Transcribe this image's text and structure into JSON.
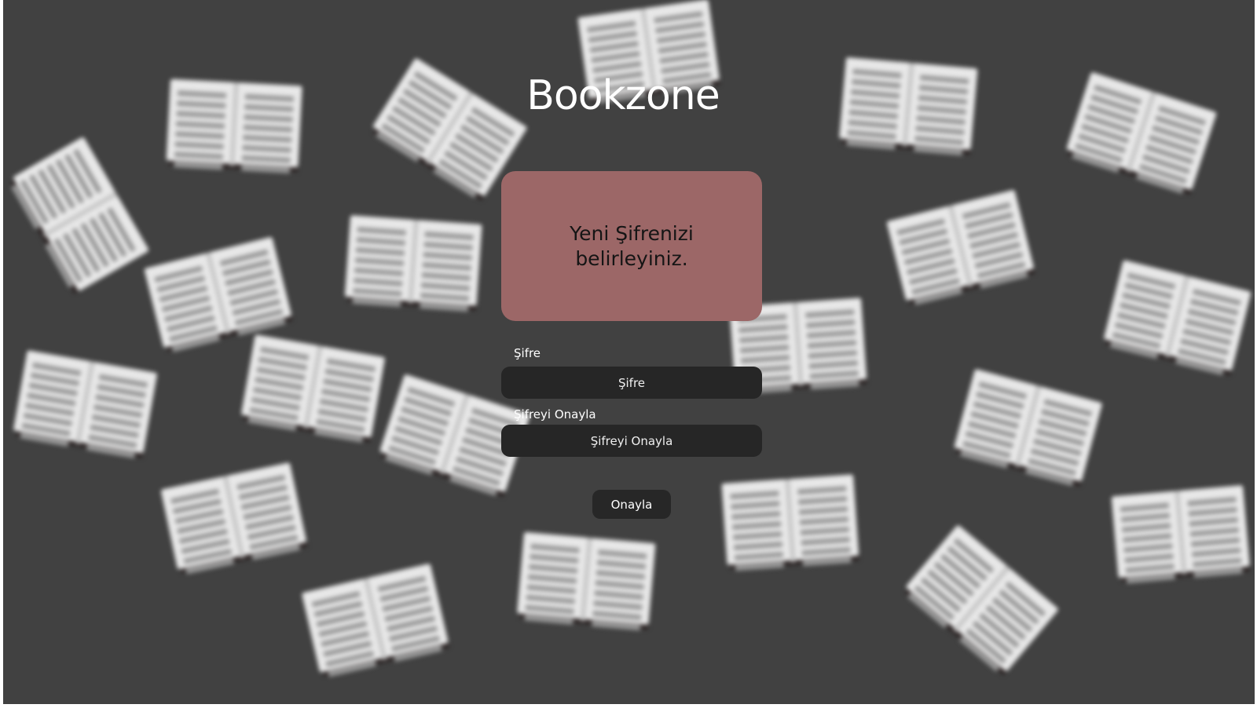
{
  "app": {
    "title": "Bookzone"
  },
  "message": {
    "text": "Yeni Şifrenizi belirleyiniz."
  },
  "password": {
    "label": "Şifre",
    "placeholder": "Şifre"
  },
  "confirm_password": {
    "label": "Şifreyi Onayla",
    "placeholder": "Şifreyi Onayla"
  },
  "submit": {
    "label": "Onayla"
  },
  "background": {
    "icon": "open-book-icon"
  },
  "colors": {
    "background": "#414141",
    "card": "#9c6767",
    "input": "#262626",
    "button": "#272727"
  }
}
